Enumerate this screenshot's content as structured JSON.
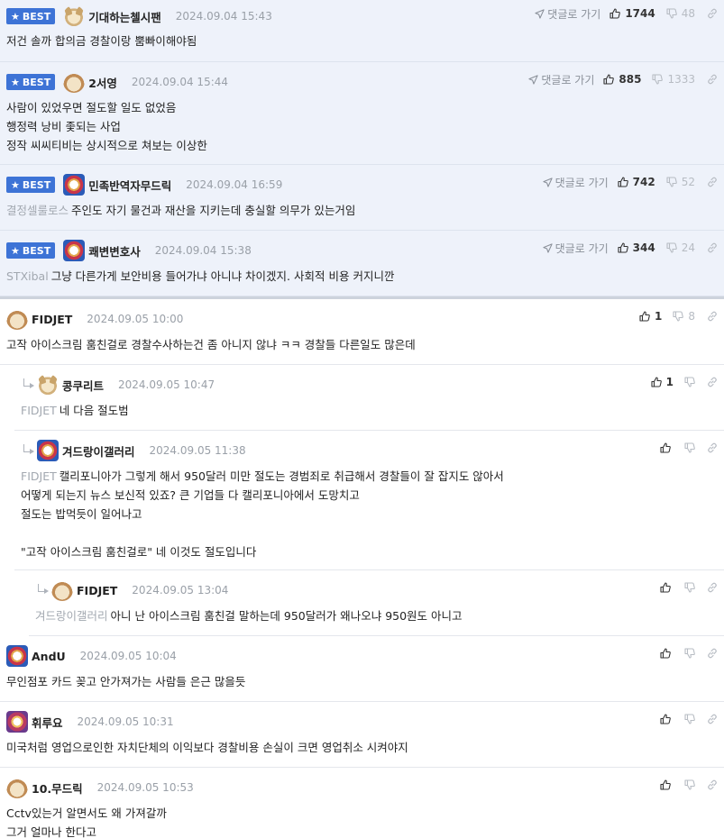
{
  "labels": {
    "best": "BEST",
    "goto_reply": "댓글로 가기"
  },
  "colors": {
    "best_badge": "#3d73d6",
    "best_background": "#eef2fa"
  },
  "comments": [
    {
      "best": true,
      "nick": "기대하는첼시팬",
      "date": "2024.09.04 15:43",
      "lines": [
        "저건 솔까 합의금 경찰이랑 뿜빠이해야됨"
      ],
      "up": "1744",
      "down": "48"
    },
    {
      "best": true,
      "nick": "2서영",
      "date": "2024.09.04 15:44",
      "lines": [
        "사람이 있었우면 절도할 일도 없었음",
        "행정력 낭비 좇되는 사업",
        "정작 씨씨티비는 상시적으로 쳐보는 이상한"
      ],
      "up": "885",
      "down": "1333"
    },
    {
      "best": true,
      "nick": "민족반역자무드릭",
      "date": "2024.09.04 16:59",
      "mention": "결정셀룰로스",
      "lines": [
        "주인도 자기 물건과 재산을 지키는데 충실할 의무가 있는거임"
      ],
      "up": "742",
      "down": "52"
    },
    {
      "best": true,
      "nick": "쾌변변호사",
      "date": "2024.09.04 15:38",
      "mention": "STXibal",
      "lines": [
        "그냥 다른가게 보안비용 들어가냐 아니냐 차이겠지. 사회적 비용 커지니깐"
      ],
      "up": "344",
      "down": "24"
    },
    {
      "nick": "FIDJET",
      "date": "2024.09.05 10:00",
      "lines": [
        "고작 아이스크림 훔친걸로 경찰수사하는건 좀 아니지 않냐 ㅋㅋ 경찰들 다른일도 많은데"
      ],
      "up": "1",
      "down": "8"
    },
    {
      "nick": "콩쿠리트",
      "date": "2024.09.05 10:47",
      "mention": "FIDJET",
      "lines": [
        "네 다음 절도범"
      ],
      "up": "1",
      "down": ""
    },
    {
      "nick": "겨드랑이갤러리",
      "date": "2024.09.05 11:38",
      "mention": "FIDJET",
      "lines": [
        "캘리포니아가 그렇게 해서 950달러 미만 절도는 경범죄로 취급해서 경찰들이 잘 잡지도 않아서",
        "어떻게 되는지 뉴스 보신적 있죠? 큰 기업들 다 캘리포니아에서 도망치고",
        "절도는 밥먹듯이 일어나고",
        "",
        "\"고작 아이스크림 훔친걸로\" 네 이것도 절도입니다"
      ],
      "up": "",
      "down": ""
    },
    {
      "nick": "FIDJET",
      "date": "2024.09.05 13:04",
      "mention": "겨드랑이갤러리",
      "lines": [
        "아니 난 아이스크림 훔친걸 말하는데 950달러가 왜나오냐 950원도 아니고"
      ],
      "up": "",
      "down": ""
    },
    {
      "nick": "AndU",
      "date": "2024.09.05 10:04",
      "lines": [
        "무인점포 카드 꽂고 안가져가는 사람들 은근 많을듯"
      ],
      "up": "",
      "down": ""
    },
    {
      "nick": "휘루요",
      "date": "2024.09.05 10:31",
      "lines": [
        "미국처럼 영업으로인한 자치단체의 이익보다 경찰비용 손실이 크면 영업취소 시켜야지"
      ],
      "up": "",
      "down": ""
    },
    {
      "nick": "10.무드릭",
      "date": "2024.09.05 10:53",
      "lines": [
        "Cctv있는거 알면서도 왜 가져갈까",
        "그거 얼마나 한다고"
      ],
      "up": "",
      "down": ""
    }
  ]
}
